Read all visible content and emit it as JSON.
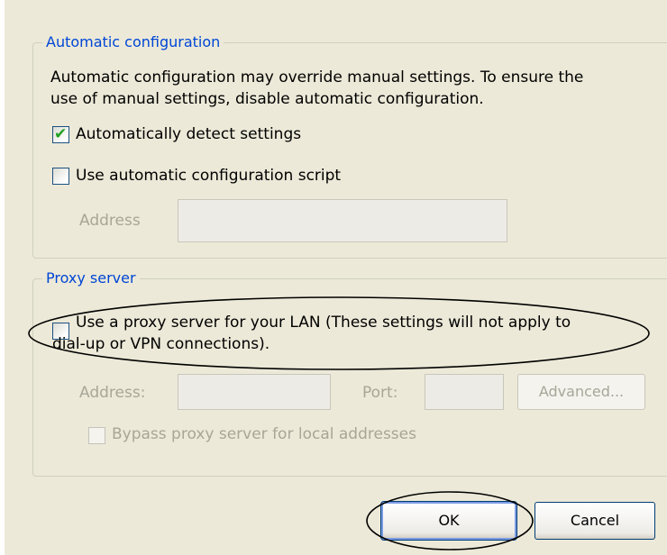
{
  "auto_config": {
    "legend": "Automatic configuration",
    "description_line1": "Automatic configuration may override manual settings.  To ensure the",
    "description_line2": "use of manual settings, disable automatic configuration.",
    "auto_detect": {
      "label": "Automatically detect settings",
      "checked": true
    },
    "auto_script": {
      "label": "Use automatic configuration script",
      "checked": false
    },
    "address_label": "Address",
    "address_value": ""
  },
  "proxy_server": {
    "legend": "Proxy server",
    "use_proxy": {
      "label_line1": "Use a proxy server for your LAN (These settings will not apply to",
      "label_line2": "dial-up or VPN connections).",
      "checked": false
    },
    "address_label": "Address:",
    "address_value": "",
    "port_label": "Port:",
    "port_value": "",
    "advanced_button": "Advanced...",
    "bypass": {
      "label": "Bypass proxy server for local addresses",
      "checked": false
    }
  },
  "buttons": {
    "ok": "OK",
    "cancel": "Cancel"
  },
  "colors": {
    "dialog_bg": "#ece9d8",
    "legend_text": "#0046d5",
    "checkmark": "#21a121",
    "disabled_text": "#a7a697",
    "annotation_ellipse": "#000000"
  },
  "annotations": {
    "ellipses": [
      "use-proxy-checkbox-highlight",
      "ok-button-highlight"
    ]
  }
}
